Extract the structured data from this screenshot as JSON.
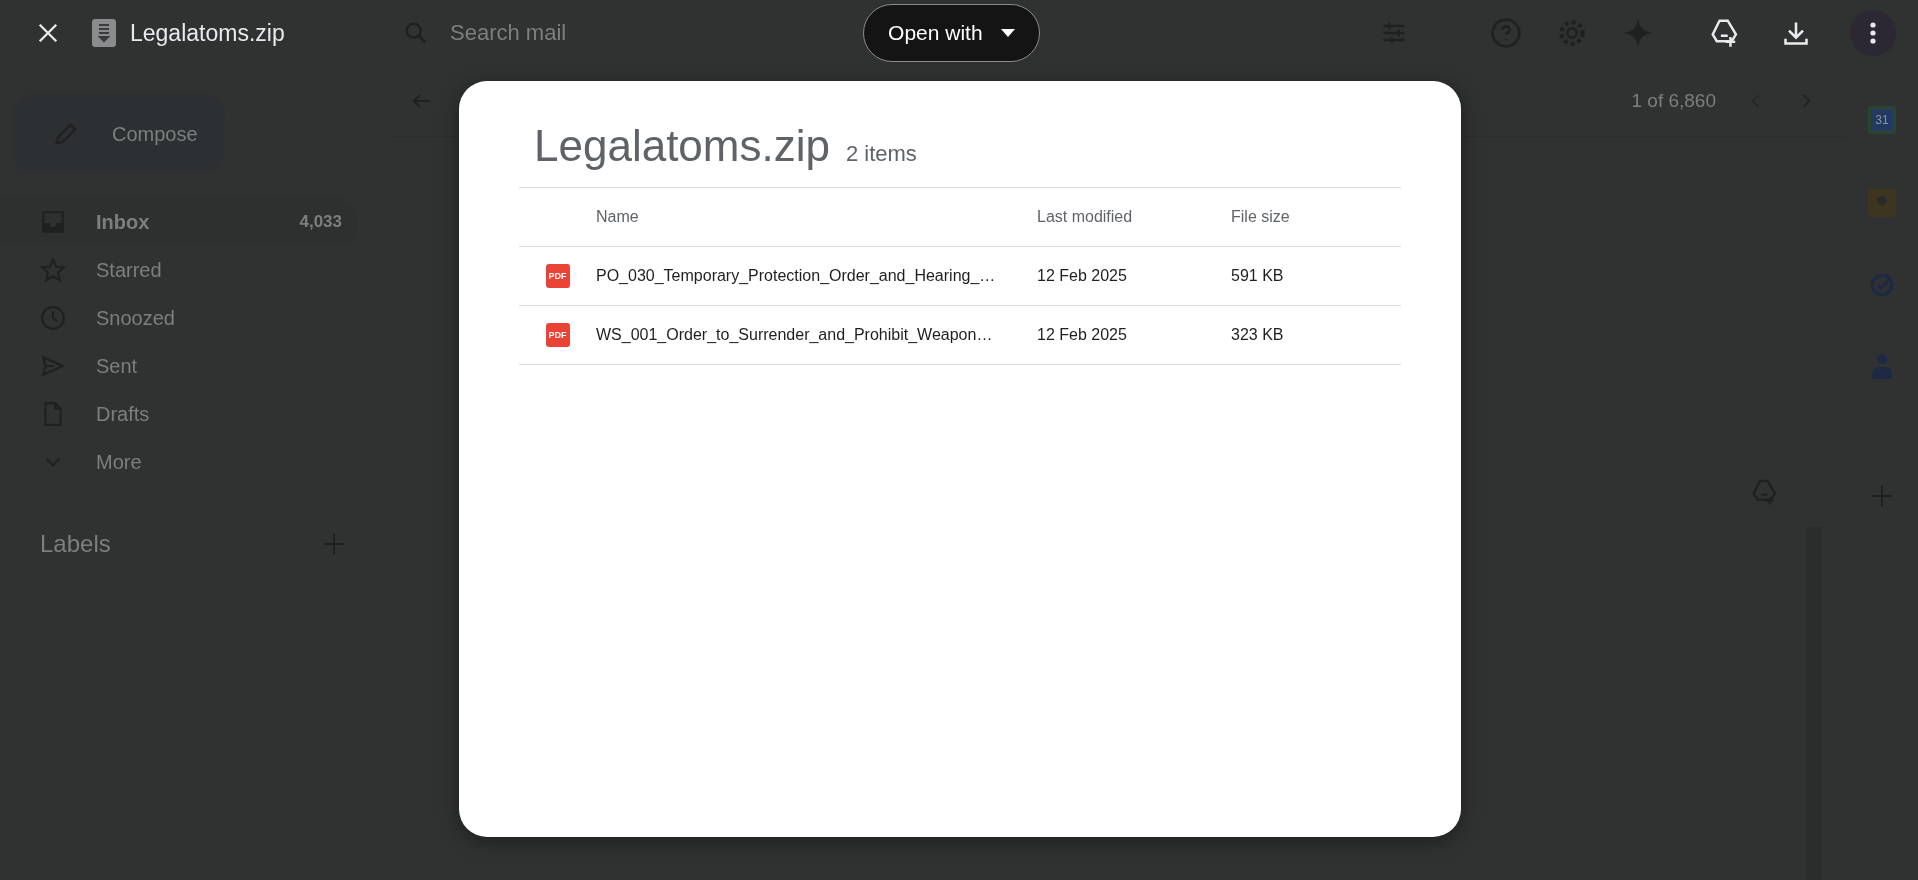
{
  "viewer": {
    "title": "Legalatoms.zip",
    "open_with": "Open with"
  },
  "gmail": {
    "search": {
      "placeholder": "Search mail"
    },
    "compose": "Compose",
    "nav": [
      {
        "label": "Inbox",
        "count": "4,033",
        "selected": true
      },
      {
        "label": "Starred",
        "selected": false
      },
      {
        "label": "Snoozed",
        "selected": false
      },
      {
        "label": "Sent",
        "selected": false
      },
      {
        "label": "Drafts",
        "selected": false
      },
      {
        "label": "More",
        "selected": false
      }
    ],
    "labels_heading": "Labels",
    "pager": "1 of 6,860",
    "calendar_day": "31"
  },
  "dialog": {
    "title": "Legalatoms.zip",
    "count": "2 items",
    "columns": [
      "Name",
      "Last modified",
      "File size"
    ],
    "files": [
      {
        "badge": "PDF",
        "name": "PO_030_Temporary_Protection_Order_and_Hearing_…",
        "modified": "12 Feb 2025",
        "size": "591 KB"
      },
      {
        "badge": "PDF",
        "name": "WS_001_Order_to_Surrender_and_Prohibit_Weapon…",
        "modified": "12 Feb 2025",
        "size": "323 KB"
      }
    ]
  }
}
